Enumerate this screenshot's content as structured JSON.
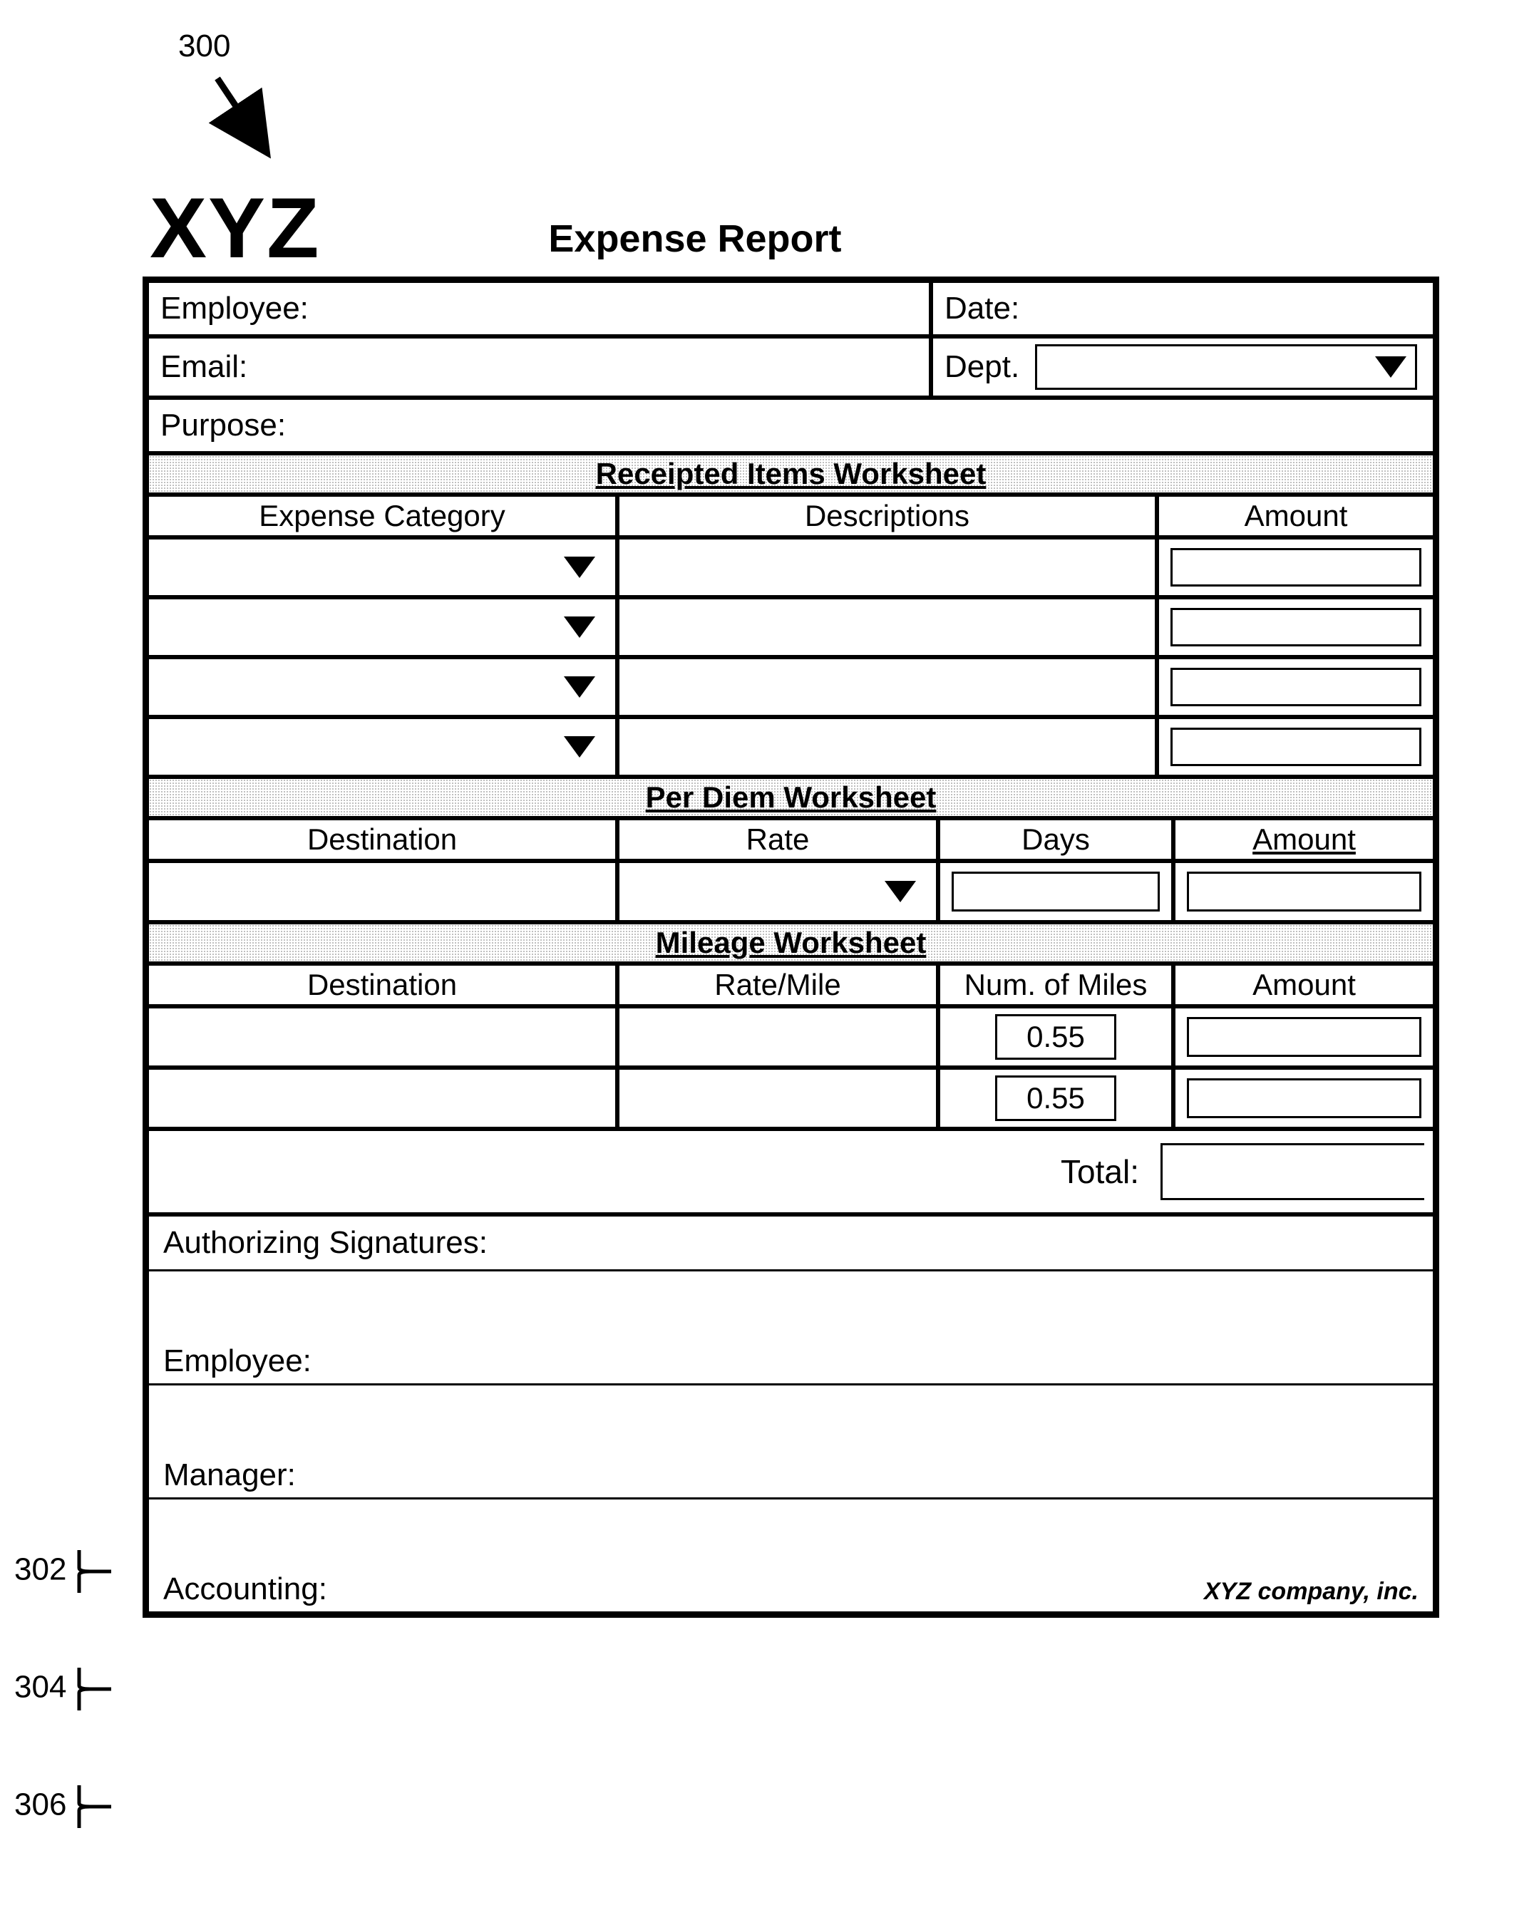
{
  "callouts": {
    "fig": "300",
    "a": "302",
    "b": "304",
    "c": "306"
  },
  "logo": "XYZ",
  "title": "Expense Report",
  "info": {
    "employee_label": "Employee:",
    "date_label": "Date:",
    "email_label": "Email:",
    "dept_label": "Dept.",
    "purpose_label": "Purpose:"
  },
  "receipted": {
    "section": "Receipted Items Worksheet",
    "cols": {
      "category": "Expense Category",
      "desc": "Descriptions",
      "amount": "Amount"
    },
    "row_count": 4
  },
  "perdiem": {
    "section": "Per Diem Worksheet",
    "cols": {
      "dest": "Destination",
      "rate": "Rate",
      "days": "Days",
      "amount": "Amount"
    }
  },
  "mileage": {
    "section": "Mileage Worksheet",
    "cols": {
      "dest": "Destination",
      "rate": "Rate/Mile",
      "miles": "Num. of Miles",
      "amount": "Amount"
    },
    "rows": [
      {
        "miles": "0.55"
      },
      {
        "miles": "0.55"
      }
    ]
  },
  "total_label": "Total:",
  "signatures": {
    "heading": "Authorizing Signatures:",
    "employee": "Employee:",
    "manager": "Manager:",
    "accounting": "Accounting:"
  },
  "footer": "XYZ company, inc."
}
